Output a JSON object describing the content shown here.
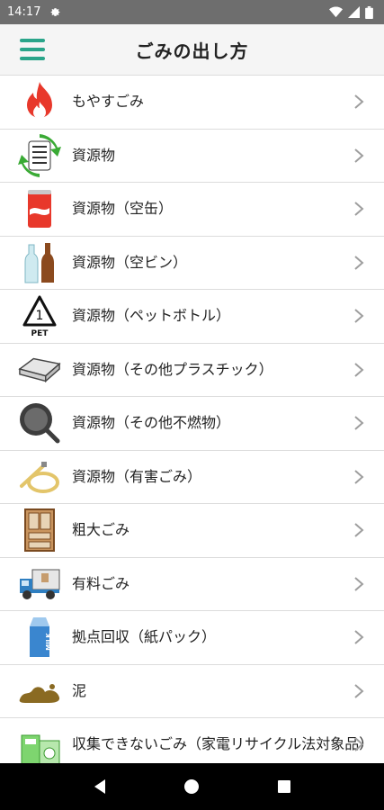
{
  "status": {
    "time": "14:17"
  },
  "header": {
    "title": "ごみの出し方"
  },
  "items": [
    {
      "label": "もやすごみ",
      "icon": "fire-icon"
    },
    {
      "label": "資源物",
      "icon": "recycle-resource-icon"
    },
    {
      "label": "資源物（空缶）",
      "icon": "can-icon"
    },
    {
      "label": "資源物（空ビン）",
      "icon": "bottles-icon"
    },
    {
      "label": "資源物（ペットボトル）",
      "icon": "pet-recycle-icon",
      "icon_text": "PET"
    },
    {
      "label": "資源物（その他プラスチック）",
      "icon": "plastic-tray-icon"
    },
    {
      "label": "資源物（その他不燃物）",
      "icon": "frying-pan-icon"
    },
    {
      "label": "資源物（有害ごみ）",
      "icon": "fluorescent-tube-icon"
    },
    {
      "label": "粗大ごみ",
      "icon": "cabinet-icon"
    },
    {
      "label": "有料ごみ",
      "icon": "truck-icon"
    },
    {
      "label": "拠点回収（紙パック）",
      "icon": "milk-carton-icon",
      "icon_text": "MILK"
    },
    {
      "label": "泥",
      "icon": "mud-icon"
    },
    {
      "label": "収集できないごみ（家電リサイクル法対象品）",
      "icon": "appliances-icon"
    }
  ],
  "colors": {
    "accent": "#2aa58a",
    "status_bar": "#6e6e6e",
    "divider": "#dcdcdc"
  }
}
